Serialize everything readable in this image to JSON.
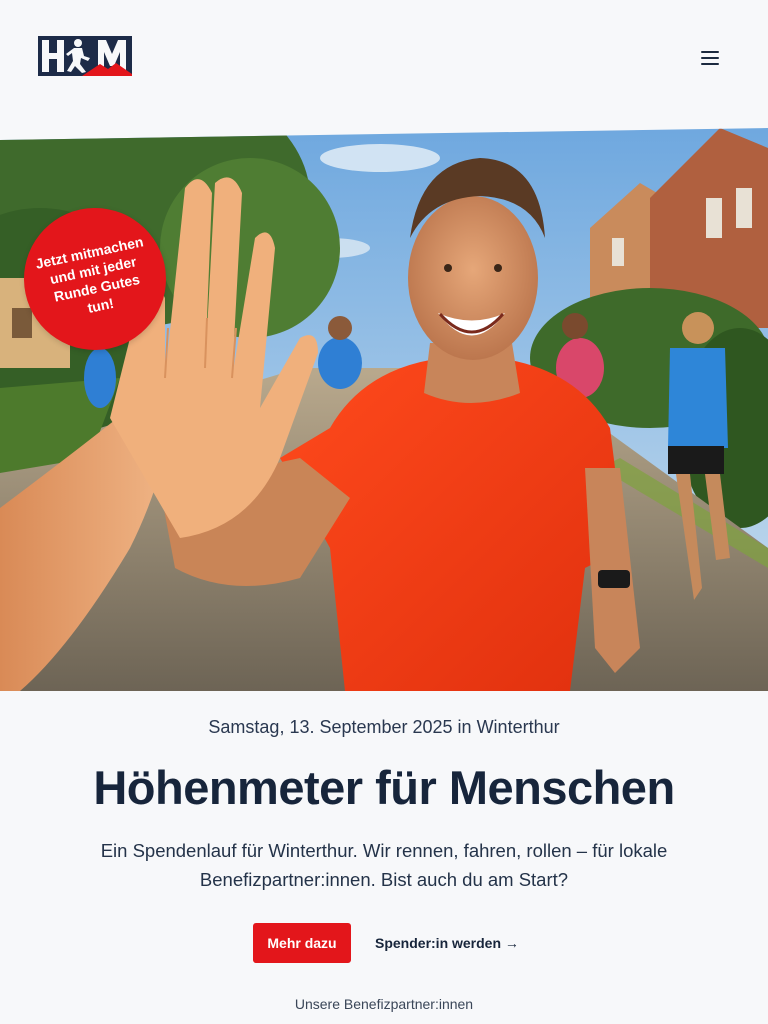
{
  "header": {
    "logo_alt": "HFM",
    "menu_icon": "hamburger-menu-icon"
  },
  "hero": {
    "badge_text": "Jetzt mitmachen\nund mit jeder\nRunde Gutes\ntun!",
    "badge_color": "#e3161b"
  },
  "main": {
    "date_line": "Samstag, 13. September 2025 in Winterthur",
    "title": "Höhenmeter für Menschen",
    "lead": "Ein Spendenlauf für Winterthur. Wir rennen, fahren, rollen – für lokale Benefizpartner:innen. Bist auch du am Start?",
    "cta_primary": "Mehr dazu",
    "cta_secondary": "Spender:in werden →",
    "partners_heading": "Unsere Benefizpartner:innen"
  },
  "colors": {
    "accent": "#e3161b",
    "navy": "#1b2a3f",
    "background": "#f7f8fa"
  }
}
